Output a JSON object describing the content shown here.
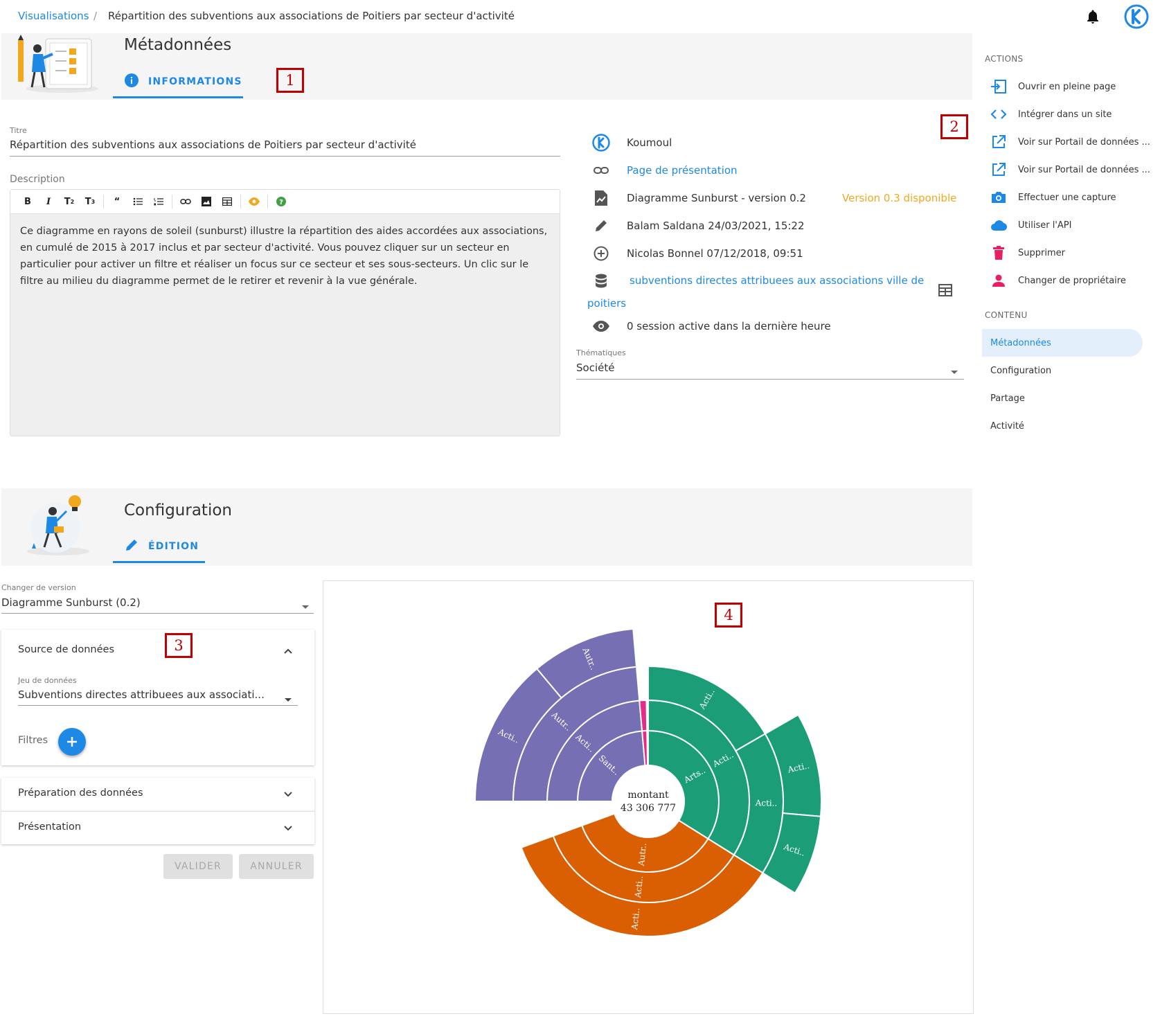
{
  "breadcrumb": {
    "link": "Visualisations",
    "separator": "/",
    "current": "Répartition des subventions aux associations de Poitiers par secteur d'activité"
  },
  "metadata_section": {
    "title": "Métadonnées",
    "tab_label": "INFORMATIONS",
    "title_field": {
      "label": "Titre",
      "value": "Répartition des subventions aux associations de Poitiers par secteur d'activité"
    },
    "description_field": {
      "label": "Description",
      "toolbar": [
        "B",
        "I",
        "T2",
        "T3",
        "quote",
        "bullet-list",
        "numbered-list",
        "link",
        "image",
        "table",
        "preview",
        "help"
      ],
      "text": "Ce diagramme en rayons de soleil (sunburst) illustre la répartition des aides accordées aux associations, en cumulé de 2015 à 2017 inclus et par secteur d'activité. Vous pouvez cliquer sur un secteur en particulier pour activer un filtre et réaliser un focus sur ce secteur et ses sous-secteurs. Un clic sur le filtre au milieu du diagramme permet de le retirer et revenir à la vue générale."
    },
    "info": {
      "owner": "Koumoul",
      "presentation_link": "Page de présentation",
      "component": "Diagramme Sunburst - version 0.2",
      "update_available": "Version 0.3 disponible",
      "updated": "Balam Saldana 24/03/2021, 15:22",
      "created": "Nicolas Bonnel 07/12/2018, 09:51",
      "dataset_line1": "subventions directes attribuees aux associations ville de",
      "dataset_line2": "poitiers",
      "sessions": "0 session active dans la dernière heure"
    },
    "topics": {
      "label": "Thématiques",
      "value": "Société"
    }
  },
  "sidebar": {
    "actions_title": "ACTIONS",
    "actions": [
      {
        "label": "Ouvrir en pleine page",
        "icon": "open-fullpage-icon"
      },
      {
        "label": "Intégrer dans un site",
        "icon": "code-icon"
      },
      {
        "label": "Voir sur Portail de données ...",
        "icon": "external-link-icon"
      },
      {
        "label": "Voir sur Portail de données ...",
        "icon": "external-link-icon"
      },
      {
        "label": "Effectuer une capture",
        "icon": "camera-icon"
      },
      {
        "label": "Utiliser l'API",
        "icon": "cloud-icon"
      },
      {
        "label": "Supprimer",
        "icon": "trash-icon"
      },
      {
        "label": "Changer de propriétaire",
        "icon": "person-icon"
      }
    ],
    "content_title": "CONTENU",
    "content": [
      {
        "label": "Métadonnées",
        "active": true
      },
      {
        "label": "Configuration",
        "active": false
      },
      {
        "label": "Partage",
        "active": false
      },
      {
        "label": "Activité",
        "active": false
      }
    ]
  },
  "config_section": {
    "title": "Configuration",
    "tab_label": "ÉDITION",
    "version_field": {
      "label": "Changer de version",
      "value": "Diagramme Sunburst (0.2)"
    },
    "data_source": {
      "title": "Source de données",
      "dataset_label": "Jeu de données",
      "dataset_value": "Subventions directes attribuees aux associati...",
      "filters_label": "Filtres"
    },
    "data_prep_title": "Préparation des données",
    "presentation_title": "Présentation",
    "validate_label": "VALIDER",
    "cancel_label": "ANNULER"
  },
  "annotations": [
    "1",
    "2",
    "3",
    "4"
  ],
  "colors": {
    "accent": "#1e88e5",
    "warning": "#f2a81d",
    "danger": "#e91e63",
    "purple": "#7570b3",
    "orange": "#d95f02",
    "green": "#1b9e77"
  },
  "chart_data": {
    "type": "sunburst",
    "center_label": "montant",
    "center_value": "43 306 777",
    "rings": [
      [
        {
          "label": "Sant..",
          "color": "#7570b3",
          "start": -90,
          "end": -5
        },
        {
          "label": "",
          "color": "#e7298a",
          "start": -5,
          "end": -1
        },
        {
          "label": "Arts..",
          "color": "#1b9e77",
          "start": 0,
          "end": 122
        },
        {
          "label": "Autr..",
          "color": "#d95f02",
          "start": 122,
          "end": 250
        }
      ],
      [
        {
          "label": "Acti..",
          "color": "#7570b3",
          "start": -90,
          "end": -5
        },
        {
          "label": "",
          "color": "#e7298a",
          "start": -5,
          "end": -1
        },
        {
          "label": "Acti..",
          "color": "#1b9e77",
          "start": 0,
          "end": 122
        },
        {
          "label": "Acti..",
          "color": "#d95f02",
          "start": 122,
          "end": 250
        }
      ],
      [
        {
          "label": "Autr..",
          "color": "#7570b3",
          "start": -90,
          "end": -5
        },
        {
          "label": "Acti..",
          "color": "#1b9e77",
          "start": 0,
          "end": 60
        },
        {
          "label": "Acti..",
          "color": "#1b9e77",
          "start": 60,
          "end": 122
        },
        {
          "label": "Acti..",
          "color": "#d95f02",
          "start": 122,
          "end": 250
        }
      ],
      [
        {
          "label": "Acti..",
          "color": "#7570b3",
          "start": -90,
          "end": -40
        },
        {
          "label": "Autr..",
          "color": "#7570b3",
          "start": -40,
          "end": -5
        },
        {
          "label": "Acti..",
          "color": "#1b9e77",
          "start": 60,
          "end": 95
        },
        {
          "label": "Acti..",
          "color": "#1b9e77",
          "start": 95,
          "end": 122
        }
      ]
    ]
  }
}
